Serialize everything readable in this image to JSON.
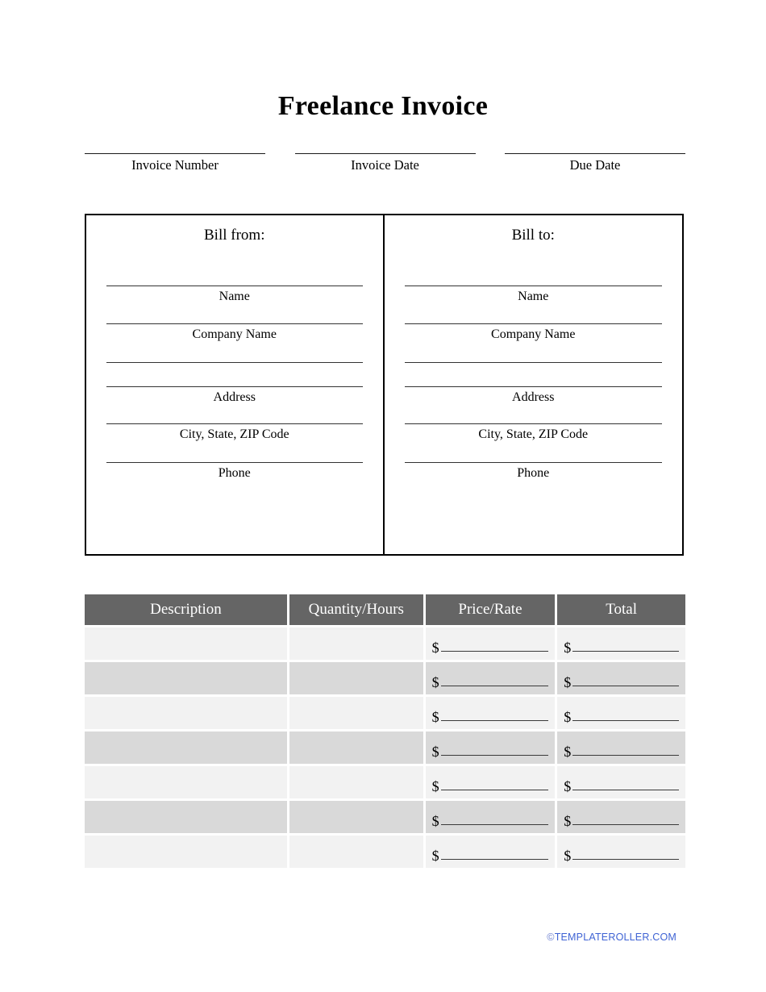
{
  "document": {
    "title": "Freelance Invoice"
  },
  "header_fields": [
    {
      "label": "Invoice Number",
      "value": ""
    },
    {
      "label": "Invoice Date",
      "value": ""
    },
    {
      "label": "Due Date",
      "value": ""
    }
  ],
  "bill_from": {
    "heading": "Bill from:",
    "fields": [
      {
        "label": "Name",
        "value": "",
        "lines": 1
      },
      {
        "label": "Company Name",
        "value": "",
        "lines": 1
      },
      {
        "label": "Address",
        "value": "",
        "lines": 2
      },
      {
        "label": "City, State, ZIP Code",
        "value": "",
        "lines": 1
      },
      {
        "label": "Phone",
        "value": "",
        "lines": 1
      }
    ]
  },
  "bill_to": {
    "heading": "Bill to:",
    "fields": [
      {
        "label": "Name",
        "value": "",
        "lines": 1
      },
      {
        "label": "Company Name",
        "value": "",
        "lines": 1
      },
      {
        "label": "Address",
        "value": "",
        "lines": 2
      },
      {
        "label": "City, State, ZIP Code",
        "value": "",
        "lines": 1
      },
      {
        "label": "Phone",
        "value": "",
        "lines": 1
      }
    ]
  },
  "items_table": {
    "columns": [
      {
        "header": "Description",
        "type": "text"
      },
      {
        "header": "Quantity/Hours",
        "type": "text"
      },
      {
        "header": "Price/Rate",
        "type": "currency"
      },
      {
        "header": "Total",
        "type": "currency"
      }
    ],
    "currency_symbol": "$",
    "row_count": 7,
    "rows": [
      {
        "description": "",
        "quantity_hours": "",
        "price_rate": "",
        "total": ""
      },
      {
        "description": "",
        "quantity_hours": "",
        "price_rate": "",
        "total": ""
      },
      {
        "description": "",
        "quantity_hours": "",
        "price_rate": "",
        "total": ""
      },
      {
        "description": "",
        "quantity_hours": "",
        "price_rate": "",
        "total": ""
      },
      {
        "description": "",
        "quantity_hours": "",
        "price_rate": "",
        "total": ""
      },
      {
        "description": "",
        "quantity_hours": "",
        "price_rate": "",
        "total": ""
      },
      {
        "description": "",
        "quantity_hours": "",
        "price_rate": "",
        "total": ""
      }
    ]
  },
  "footer": {
    "copyright_mark": "©",
    "text": "TEMPLATEROLLER.COM"
  },
  "colors": {
    "table_header_bg": "#656565",
    "table_header_text": "#ffffff",
    "row_light": "#f2f2f2",
    "row_dark": "#d9d9d9",
    "rule": "#333333",
    "border": "#000000",
    "footer_link": "#3f63d4"
  }
}
